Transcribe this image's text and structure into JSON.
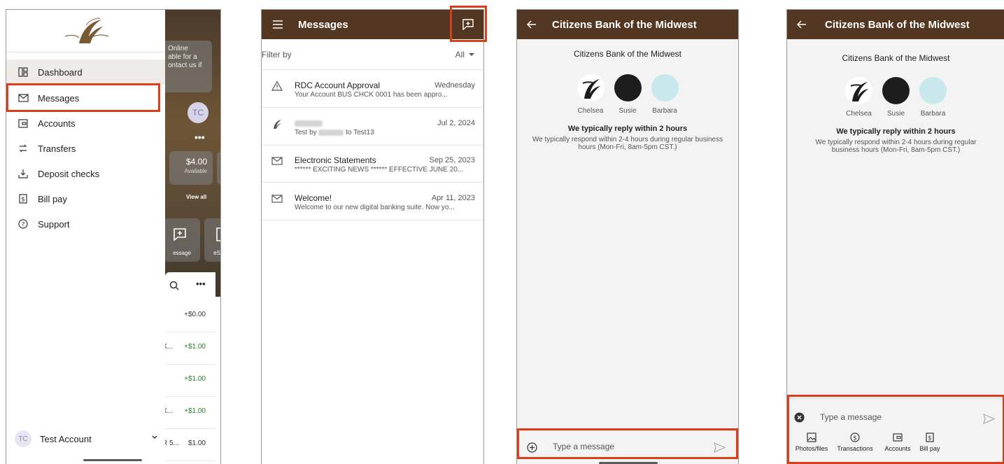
{
  "drawer_screen": {
    "menu": [
      {
        "label": "Dashboard",
        "icon": "dashboard-icon",
        "active": true
      },
      {
        "label": "Messages",
        "icon": "mail-icon"
      },
      {
        "label": "Accounts",
        "icon": "wallet-icon"
      },
      {
        "label": "Transfers",
        "icon": "transfer-icon"
      },
      {
        "label": "Deposit checks",
        "icon": "deposit-icon"
      },
      {
        "label": "Bill pay",
        "icon": "dollar-icon"
      },
      {
        "label": "Support",
        "icon": "help-icon"
      }
    ],
    "account": {
      "initials": "TC",
      "name": "Test Account"
    },
    "background": {
      "banner_lines": [
        "Online",
        "able for a",
        "ontact us if"
      ],
      "avatar_initials": "TC",
      "balance_amount": "$4.00",
      "balance_label": "Available",
      "view_all": "View all",
      "quick_actions": [
        "essage",
        "eStater"
      ],
      "rows": [
        {
          "desc": "",
          "amount": "+$0.00",
          "type": "neg"
        },
        {
          "desc": "X...",
          "amount": "+$1.00",
          "type": "pos"
        },
        {
          "desc": "",
          "amount": "+$1.00",
          "type": "pos"
        },
        {
          "desc": "X...",
          "amount": "+$1.00",
          "type": "pos"
        },
        {
          "desc": "R 5...",
          "amount": "$1.00",
          "type": "neg"
        }
      ]
    }
  },
  "messages_screen": {
    "title": "Messages",
    "filter_label": "Filter by",
    "filter_value": "All",
    "messages": [
      {
        "icon": "warning-icon",
        "subject": "RDC Account Approval",
        "date": "Wednesday",
        "preview": "Your Account BUS CHCK     0001 has been appro..."
      },
      {
        "icon": "eagle-icon",
        "subject": "",
        "date": "Jul 2, 2024",
        "preview_prefix": "Test by",
        "preview_suffix": "to Test13"
      },
      {
        "icon": "mail-icon",
        "subject": "Electronic Statements",
        "date": "Sep 25, 2023",
        "preview": "****** EXCITING NEWS ****** EFFECTIVE JUNE 20..."
      },
      {
        "icon": "mail-icon",
        "subject": "Welcome!",
        "date": "Apr 11, 2023",
        "preview": "Welcome to our new digital banking suite. Now yo..."
      }
    ]
  },
  "conversation": {
    "title": "Citizens Bank of the Midwest",
    "bank_name": "Citizens Bank of the Midwest",
    "agents": [
      {
        "name": "Chelsea",
        "color": "#ffffff"
      },
      {
        "name": "Susie",
        "color": "#1d1d1d"
      },
      {
        "name": "Barbara",
        "color": "#c9e8ee"
      }
    ],
    "reply_heading": "We typically reply within 2 hours",
    "reply_sub": "We typically respond within 2-4 hours during regular business hours (Mon-Fri, 8am-5pm CST.)",
    "composer_placeholder": "Type a message",
    "attachments": [
      {
        "label": "Photos/files",
        "icon": "image-icon"
      },
      {
        "label": "Transactions",
        "icon": "dollar-circle-icon"
      },
      {
        "label": "Accounts",
        "icon": "wallet-icon"
      },
      {
        "label": "Bill pay",
        "icon": "dollar-icon"
      }
    ]
  },
  "colors": {
    "brand": "#533722",
    "highlight": "#d7401c"
  }
}
